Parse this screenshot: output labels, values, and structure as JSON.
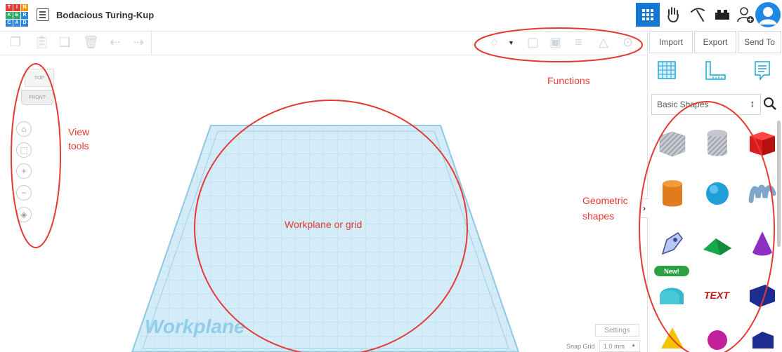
{
  "header": {
    "logo_letters": [
      "T",
      "I",
      "N",
      "K",
      "E",
      "R",
      "C",
      "A",
      "D"
    ],
    "project_title": "Bodacious Turing-Kup"
  },
  "right_actions": {
    "import": "Import",
    "export": "Export",
    "send_to": "Send To"
  },
  "shape_library": {
    "category": "Basic Shapes",
    "new_badge": "New!"
  },
  "view_cube": {
    "top": "TOP",
    "front": "FRONT"
  },
  "workplane": {
    "label": "Workplane"
  },
  "bottom": {
    "settings": "Settings",
    "snap_grid_label": "Snap Grid",
    "snap_grid_value": "1.0 mm"
  },
  "annotations": {
    "functions": "Functions",
    "view_tools_1": "View",
    "view_tools_2": "tools",
    "workplane_grid": "Workplane or grid",
    "geometric_1": "Geometric",
    "geometric_2": "shapes"
  },
  "colors": {
    "accent": "#1477d1",
    "annotation": "#e53935",
    "workplane": "#cfe9f5"
  }
}
